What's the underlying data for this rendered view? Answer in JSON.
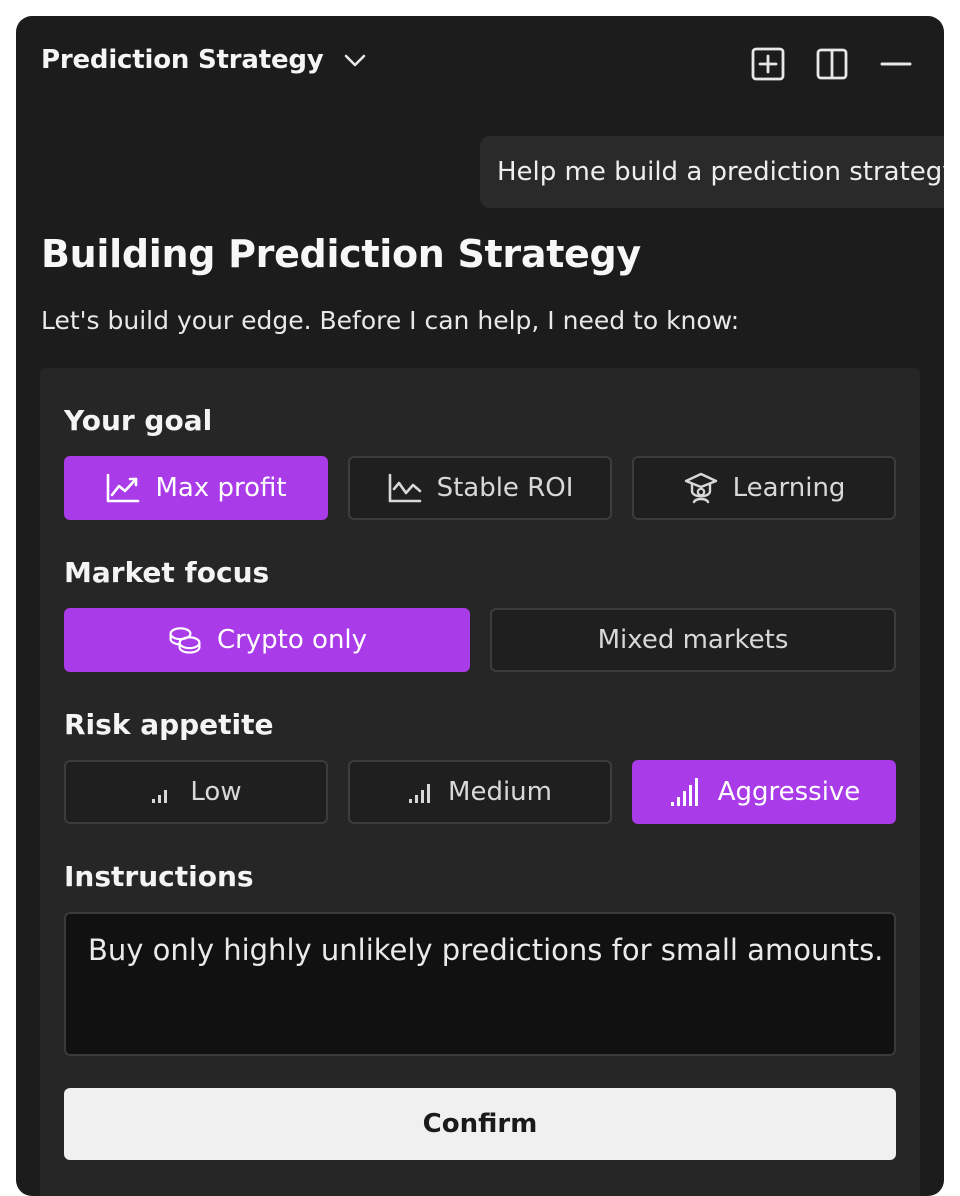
{
  "header": {
    "title": "Prediction Strategy",
    "icons": [
      "chevron-down-icon",
      "add-box-icon",
      "split-view-icon",
      "minimize-icon"
    ]
  },
  "user_message": "Help me build a prediction strategy",
  "page_title": "Building Prediction Strategy",
  "intro": "Let's build your edge. Before I can help, I need to know:",
  "form": {
    "goal": {
      "label": "Your goal",
      "options": [
        {
          "label": "Max profit",
          "icon": "trend-up-icon",
          "selected": true
        },
        {
          "label": "Stable ROI",
          "icon": "line-chart-icon",
          "selected": false
        },
        {
          "label": "Learning",
          "icon": "graduation-cap-icon",
          "selected": false
        }
      ]
    },
    "market": {
      "label": "Market focus",
      "options": [
        {
          "label": "Crypto only",
          "icon": "coins-icon",
          "selected": true
        },
        {
          "label": "Mixed markets",
          "icon": "",
          "selected": false
        }
      ]
    },
    "risk": {
      "label": "Risk appetite",
      "options": [
        {
          "label": "Low",
          "icon": "signal-low-icon",
          "selected": false
        },
        {
          "label": "Medium",
          "icon": "signal-medium-icon",
          "selected": false
        },
        {
          "label": "Aggressive",
          "icon": "signal-high-icon",
          "selected": true
        }
      ]
    },
    "instructions": {
      "label": "Instructions",
      "value": "Buy only highly unlikely predictions for small amounts."
    },
    "confirm_label": "Confirm"
  },
  "colors": {
    "panel_bg": "#1c1c1c",
    "card_bg": "#262626",
    "accent": "#a93be8",
    "confirm_bg": "#f0f0f0"
  }
}
